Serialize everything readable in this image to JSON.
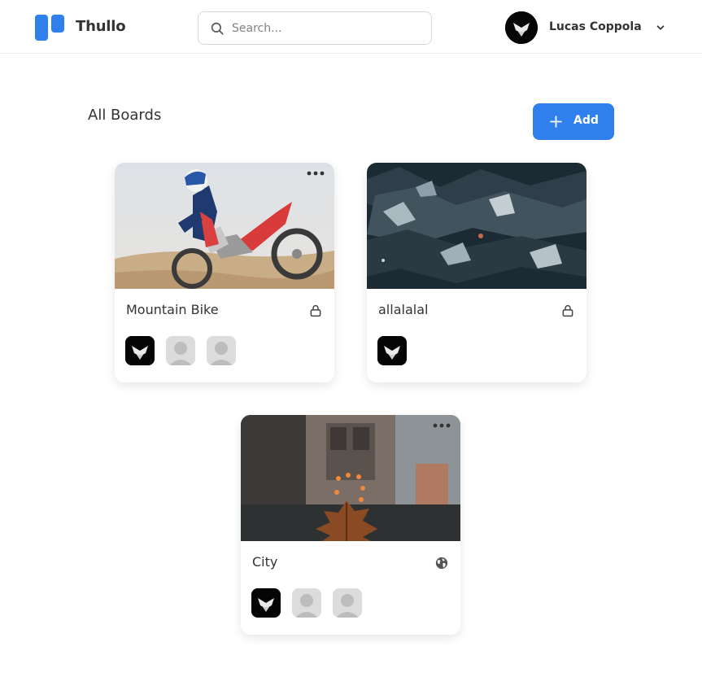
{
  "header": {
    "brand": "Thullo",
    "search_placeholder": "Search...",
    "user_name": "Lucas Coppola"
  },
  "main": {
    "title": "All Boards",
    "add_label": "Add"
  },
  "boards": [
    {
      "title": "Mountain Bike",
      "visibility": "lock-icon",
      "members": [
        "dark-avatar",
        "placeholder-avatar",
        "placeholder-avatar"
      ]
    },
    {
      "title": "allalalal",
      "visibility": "lock-icon",
      "members": [
        "dark-avatar"
      ]
    },
    {
      "title": "City",
      "visibility": "globe-icon",
      "members": [
        "dark-avatar",
        "placeholder-avatar",
        "placeholder-avatar"
      ]
    }
  ],
  "colors": {
    "accent": "#2f80ed",
    "text": "#333333",
    "placeholder": "#828282"
  }
}
